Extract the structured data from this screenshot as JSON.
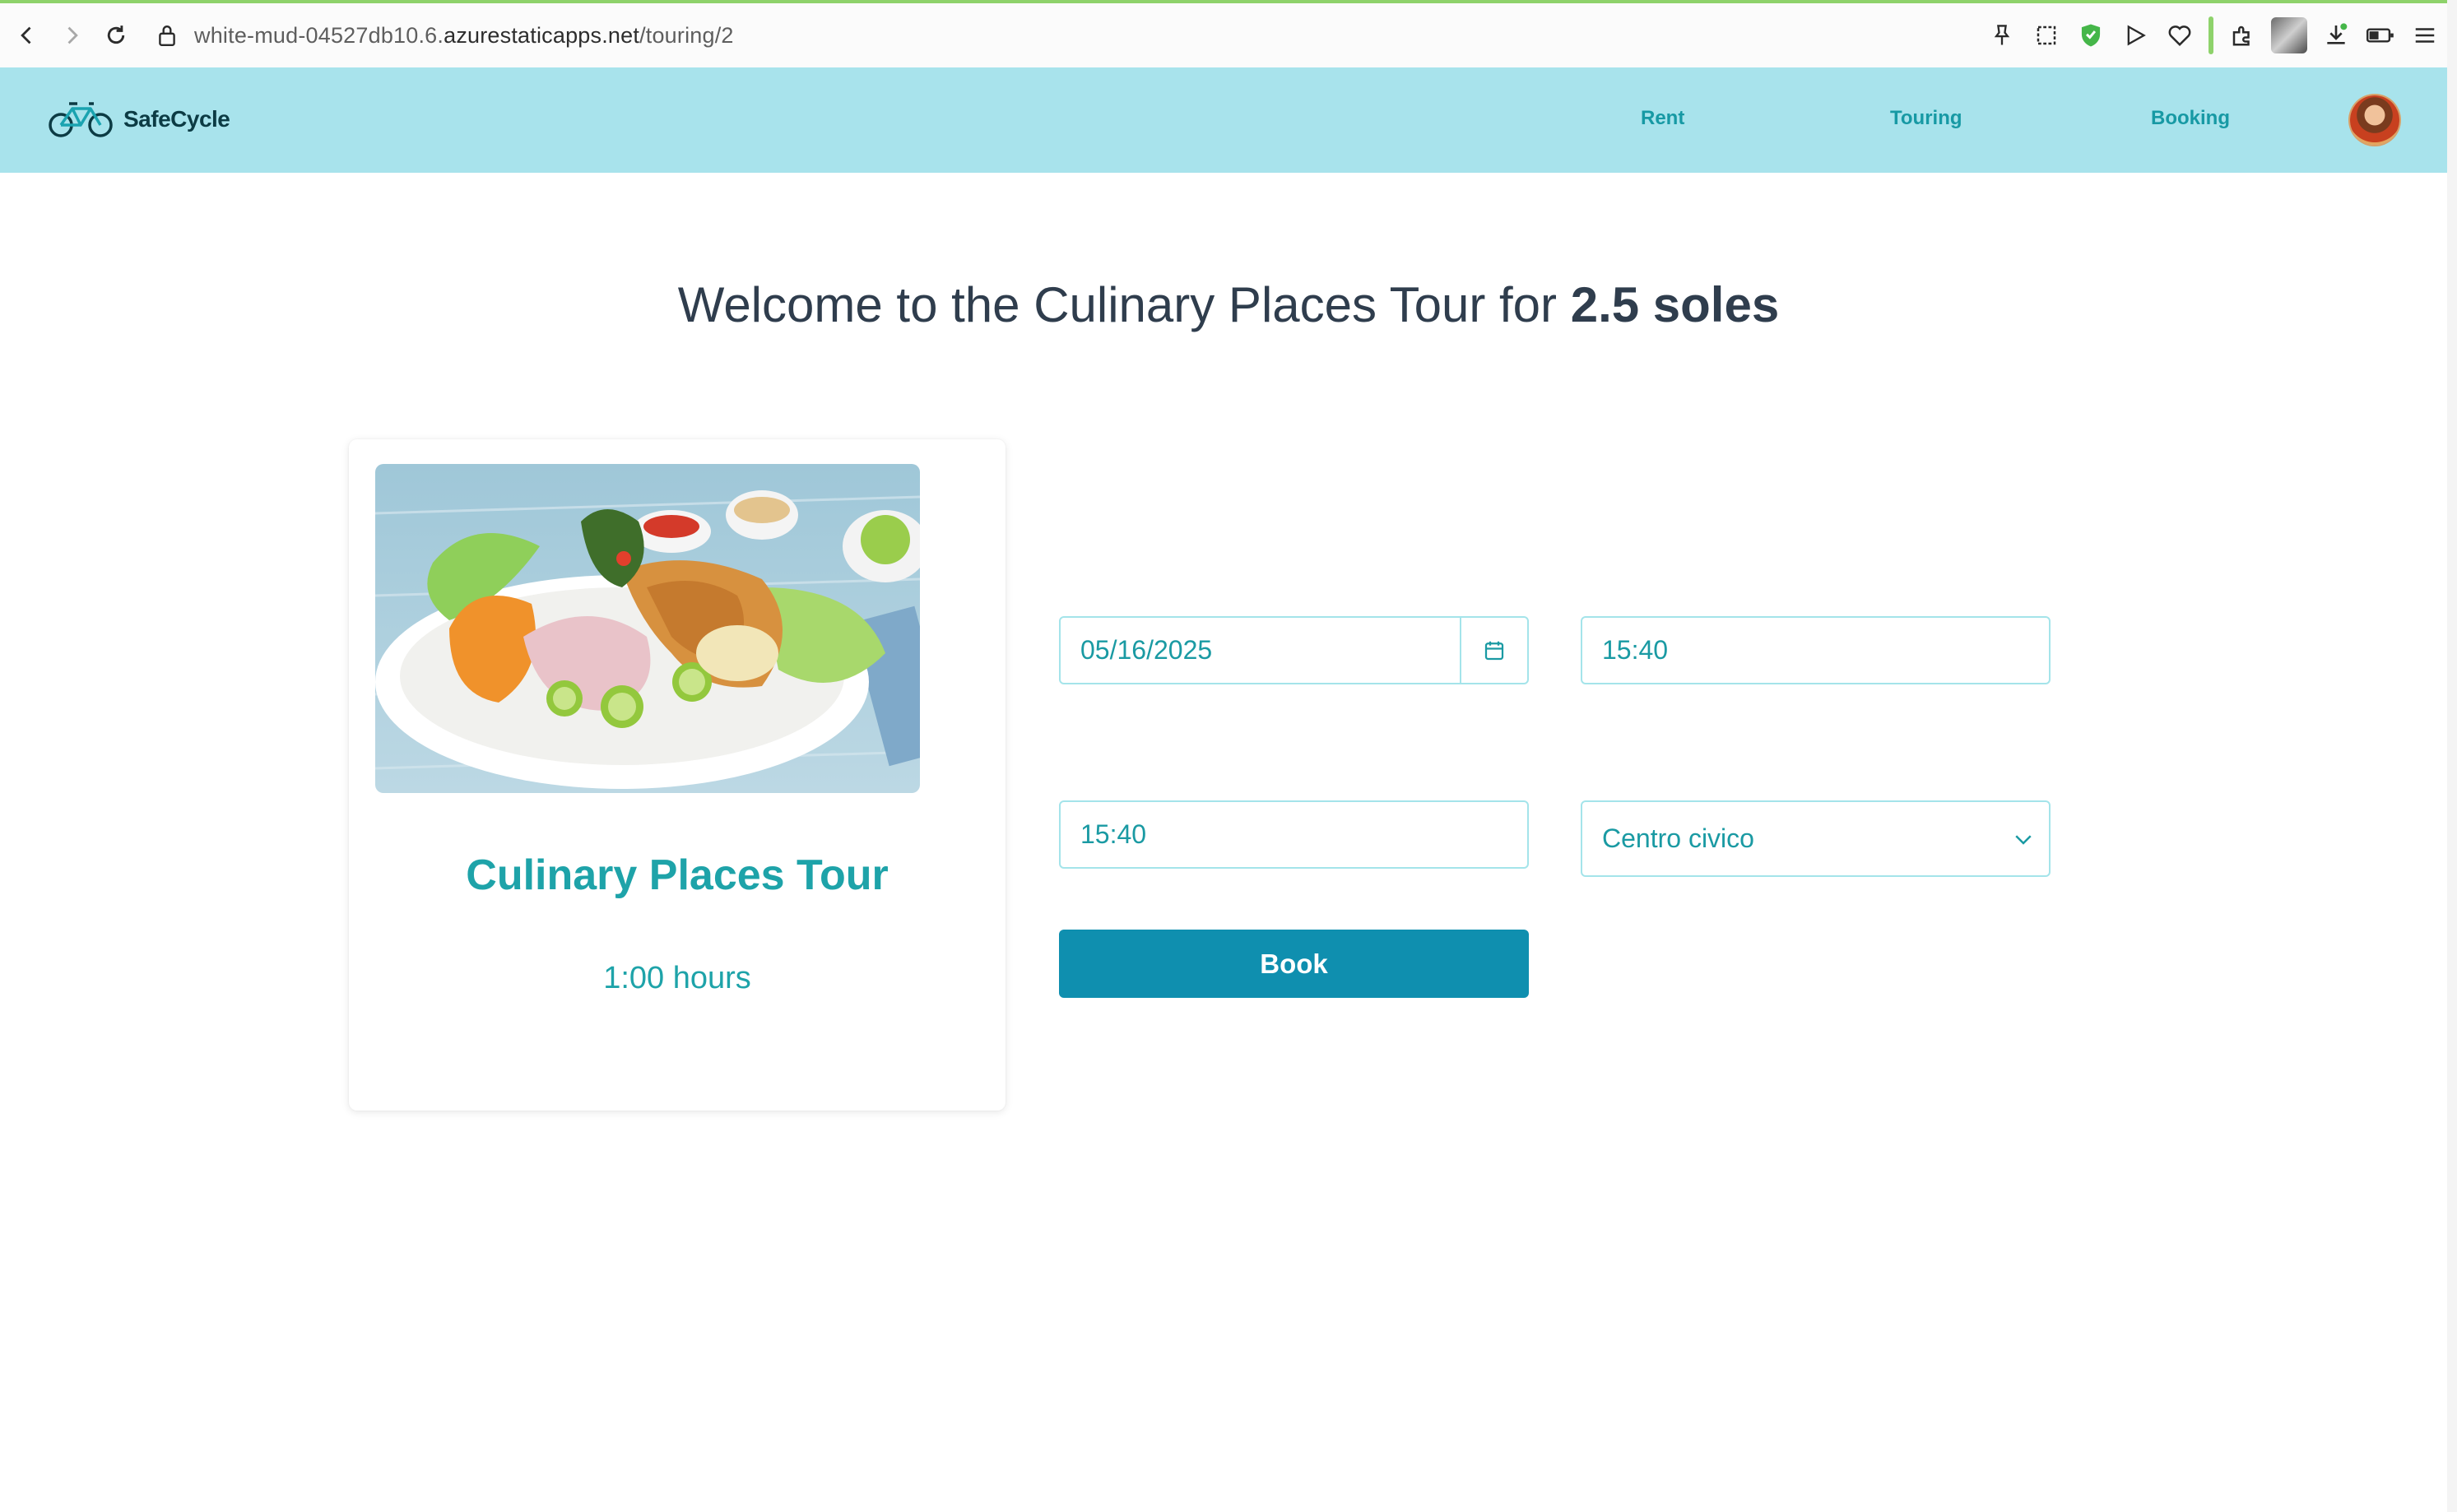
{
  "browser": {
    "url_prefix": "white-mud-04527db10.6.",
    "url_domain": "azurestaticapps.net",
    "url_path": "/touring/2"
  },
  "app": {
    "brand": "SafeCycle",
    "nav": {
      "rent": "Rent",
      "touring": "Touring",
      "booking": "Booking"
    }
  },
  "page": {
    "welcome_prefix": "Welcome to the Culinary Places Tour for",
    "price": "2.5 soles",
    "tour": {
      "name": "Culinary Places Tour",
      "duration": "1:00 hours"
    },
    "form": {
      "date": "05/16/2025",
      "start_time": "15:40",
      "end_time": "15:40",
      "place": "Centro civico",
      "book_label": "Book"
    }
  },
  "colors": {
    "header_bg": "#a8e3ec",
    "accent": "#1ea3a9",
    "button": "#0f8faf",
    "title_text": "#2f3d4d"
  }
}
